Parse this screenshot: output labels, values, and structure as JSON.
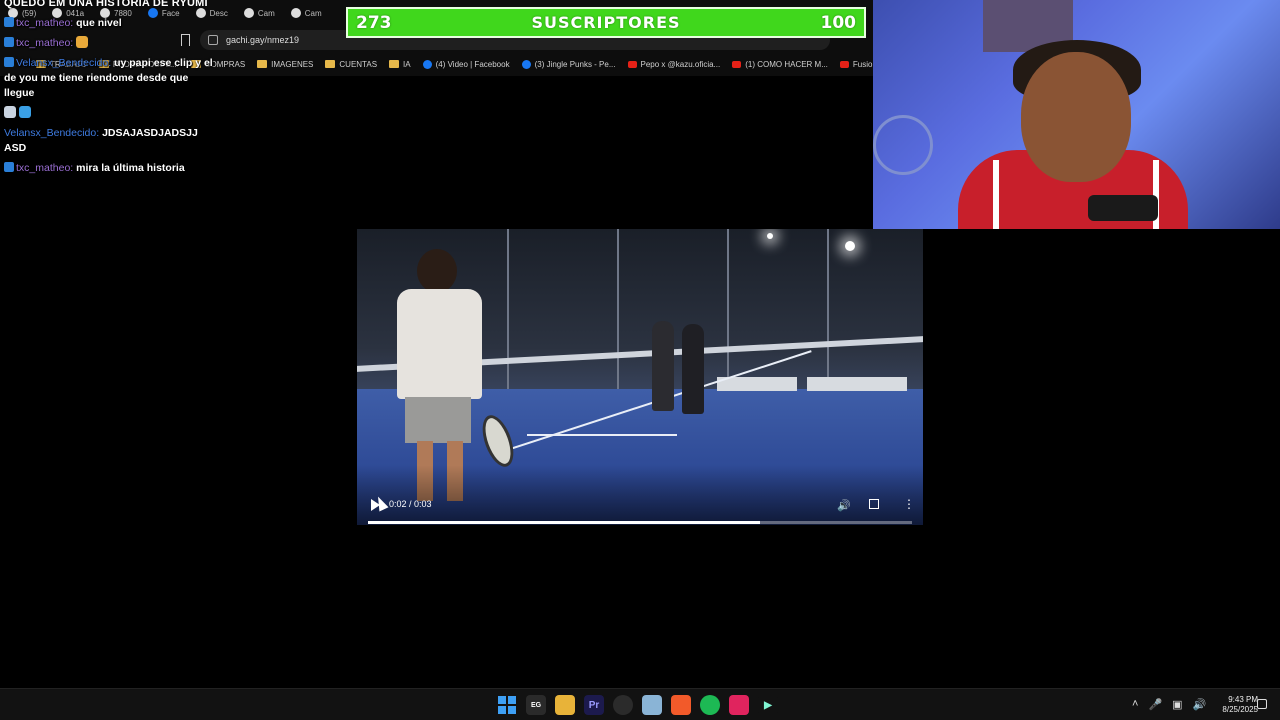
{
  "stream": {
    "title_partial": "QUEDO EM UNA HISTORIA DE RYUMI"
  },
  "browser": {
    "tabs": [
      "(59)",
      "041a",
      "7880",
      "Face",
      "Desc",
      "Cam",
      "Cam"
    ],
    "url": "gachi.gay/nmez19",
    "bookmarks": [
      {
        "label": "TRABAJO",
        "icon": "folder-icon"
      },
      {
        "label": "REDES SOCIAL...",
        "icon": "folder-icon"
      },
      {
        "label": "COMPRAS",
        "icon": "folder-icon"
      },
      {
        "label": "IMAGENES",
        "icon": "folder-icon"
      },
      {
        "label": "CUENTAS",
        "icon": "folder-icon"
      },
      {
        "label": "IA",
        "icon": "folder-icon"
      },
      {
        "label": "(4) Video | Facebook",
        "icon": "facebook-icon"
      },
      {
        "label": "(3) Jingle Punks - Pe...",
        "icon": "facebook-icon"
      },
      {
        "label": "Pepo x @kazu.oficia...",
        "icon": "youtube-icon"
      },
      {
        "label": "(1) COMO HACER M...",
        "icon": "youtube-icon"
      },
      {
        "label": "Fusion Cl",
        "icon": "youtube-icon"
      }
    ]
  },
  "chat": {
    "messages": [
      {
        "user": "txc_matheo",
        "text": "que nivel",
        "user_color": "#9b6fd4"
      },
      {
        "user": "txc_matheo",
        "text": "",
        "user_color": "#9b6fd4"
      },
      {
        "user": "Velansx_Bendecido",
        "text": "uy papi ese clip y el de you me tiene riendome desde que llegue",
        "user_color": "#3e7be0"
      },
      {
        "user": "",
        "text": "",
        "user_color": "#3e7be0"
      },
      {
        "user": "Velansx_Bendecido",
        "text": "JDSAJASDJADSJJ ASD",
        "user_color": "#3e7be0"
      },
      {
        "user": "txc_matheo",
        "text": "mira la última historia",
        "user_color": "#9b6fd4"
      }
    ]
  },
  "goal": {
    "current": "273",
    "label": "SUSCRIPTORES",
    "target": "100",
    "color": "#40d71c"
  },
  "video": {
    "time": "0:02 / 0:03",
    "progress": 0.72
  },
  "taskbar": {
    "apps": [
      "windows-start-icon",
      "epic-games-icon",
      "file-explorer-icon",
      "premiere-pro-icon",
      "obs-icon",
      "notepad-icon",
      "brave-browser-icon",
      "spotify-icon",
      "tiktok-icon",
      "streamlabs-icon"
    ],
    "time": "9:43 PM",
    "date": "8/25/2025"
  }
}
